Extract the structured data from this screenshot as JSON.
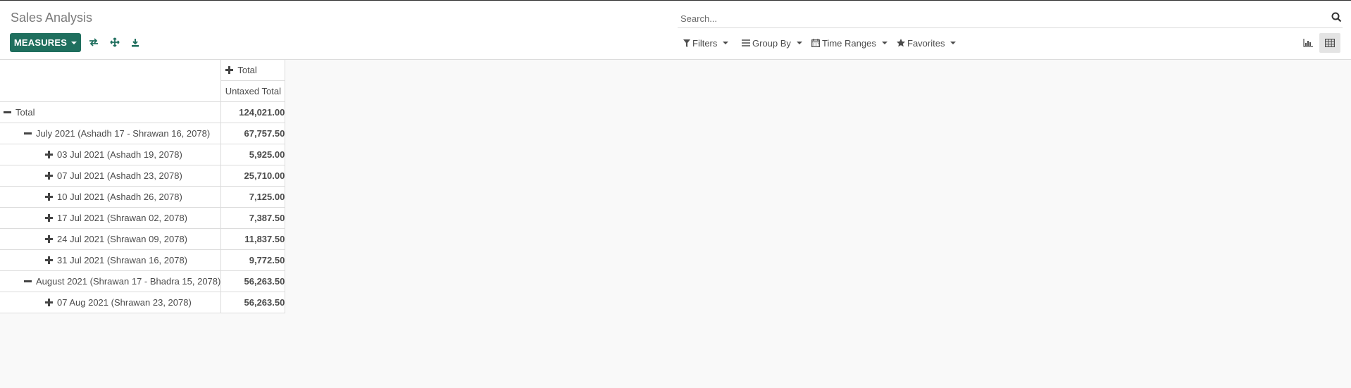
{
  "breadcrumb": "Sales Analysis",
  "toolbar": {
    "measures_label": "MEASURES",
    "icons": [
      "flip-axis-icon",
      "expand-all-icon",
      "download-icon"
    ]
  },
  "search": {
    "placeholder": "Search..."
  },
  "filters": {
    "filters_label": "Filters",
    "group_by_label": "Group By",
    "time_ranges_label": "Time Ranges",
    "favorites_label": "Favorites"
  },
  "views": [
    "graph-view-icon",
    "pivot-view-icon"
  ],
  "pivot": {
    "col_header": "Total",
    "measure": "Untaxed Total",
    "rows": [
      {
        "label": "Total",
        "value": "124,021.00",
        "level": 0,
        "expanded": true
      },
      {
        "label": "July 2021 (Ashadh 17 - Shrawan 16, 2078)",
        "value": "67,757.50",
        "level": 1,
        "expanded": true
      },
      {
        "label": "03 Jul 2021 (Ashadh 19, 2078)",
        "value": "5,925.00",
        "level": 2,
        "expanded": false
      },
      {
        "label": "07 Jul 2021 (Ashadh 23, 2078)",
        "value": "25,710.00",
        "level": 2,
        "expanded": false
      },
      {
        "label": "10 Jul 2021 (Ashadh 26, 2078)",
        "value": "7,125.00",
        "level": 2,
        "expanded": false
      },
      {
        "label": "17 Jul 2021 (Shrawan 02, 2078)",
        "value": "7,387.50",
        "level": 2,
        "expanded": false
      },
      {
        "label": "24 Jul 2021 (Shrawan 09, 2078)",
        "value": "11,837.50",
        "level": 2,
        "expanded": false
      },
      {
        "label": "31 Jul 2021 (Shrawan 16, 2078)",
        "value": "9,772.50",
        "level": 2,
        "expanded": false
      },
      {
        "label": "August 2021 (Shrawan 17 - Bhadra 15, 2078)",
        "value": "56,263.50",
        "level": 1,
        "expanded": true
      },
      {
        "label": "07 Aug 2021 (Shrawan 23, 2078)",
        "value": "56,263.50",
        "level": 2,
        "expanded": false
      }
    ]
  },
  "colors": {
    "primary": "#1f6f5e",
    "background": "#f9f9f9"
  }
}
